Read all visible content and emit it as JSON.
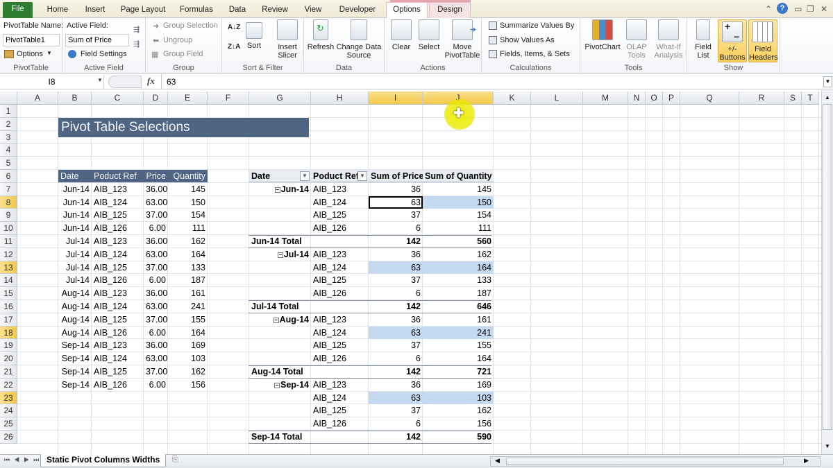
{
  "ribbon_tabs": [
    {
      "label": "File"
    },
    {
      "label": "Home"
    },
    {
      "label": "Insert"
    },
    {
      "label": "Page Layout"
    },
    {
      "label": "Formulas"
    },
    {
      "label": "Data"
    },
    {
      "label": "Review"
    },
    {
      "label": "View"
    },
    {
      "label": "Developer"
    },
    {
      "label": "Options"
    },
    {
      "label": "Design"
    }
  ],
  "ribbon": {
    "pivottable": {
      "name_label": "PivotTable Name:",
      "name_value": "PivotTable1",
      "options_label": "Options",
      "group_label": "PivotTable"
    },
    "active_field": {
      "label": "Active Field:",
      "value": "Sum of Price",
      "settings_label": "Field Settings",
      "group_label": "Active Field"
    },
    "group": {
      "selection": "Group Selection",
      "ungroup": "Ungroup",
      "field": "Group Field",
      "group_label": "Group"
    },
    "sort_filter": {
      "sort": "Sort",
      "insert_slicer": "Insert Slicer",
      "group_label": "Sort & Filter"
    },
    "data": {
      "refresh": "Refresh",
      "change_source": "Change Data Source",
      "group_label": "Data"
    },
    "actions": {
      "clear": "Clear",
      "select": "Select",
      "move": "Move PivotTable",
      "group_label": "Actions"
    },
    "calculations": {
      "summarize": "Summarize Values By",
      "show_values": "Show Values As",
      "fields_items": "Fields, Items, & Sets",
      "group_label": "Calculations"
    },
    "tools": {
      "pivotchart": "PivotChart",
      "olap": "OLAP Tools",
      "whatif": "What-If Analysis",
      "group_label": "Tools"
    },
    "show": {
      "field_list": "Field List",
      "buttons": "+/- Buttons",
      "headers": "Field Headers",
      "group_label": "Show"
    }
  },
  "formula_bar": {
    "name_box": "I8",
    "fx": "fx",
    "value": "63"
  },
  "columns": [
    "A",
    "B",
    "C",
    "D",
    "E",
    "F",
    "G",
    "H",
    "I",
    "J",
    "K",
    "L",
    "M",
    "N",
    "O",
    "P",
    "Q",
    "R",
    "S",
    "T"
  ],
  "selected_columns": [
    "I",
    "J"
  ],
  "rows": [
    "1",
    "2",
    "3",
    "4",
    "5",
    "6",
    "7",
    "8",
    "9",
    "10",
    "11",
    "12",
    "13",
    "14",
    "15",
    "16",
    "17",
    "18",
    "19",
    "20",
    "21",
    "22",
    "23",
    "24",
    "25",
    "26"
  ],
  "selected_rows": [
    "8",
    "13",
    "18",
    "23"
  ],
  "sheet_title": "Pivot Table Selections",
  "source_table": {
    "headers": [
      "Date",
      "Poduct Ref",
      "Price",
      "Quantity"
    ],
    "rows": [
      [
        "Jun-14",
        "AIB_123",
        "36.00",
        "145"
      ],
      [
        "Jun-14",
        "AIB_124",
        "63.00",
        "150"
      ],
      [
        "Jun-14",
        "AIB_125",
        "37.00",
        "154"
      ],
      [
        "Jun-14",
        "AIB_126",
        "6.00",
        "111"
      ],
      [
        "Jul-14",
        "AIB_123",
        "36.00",
        "162"
      ],
      [
        "Jul-14",
        "AIB_124",
        "63.00",
        "164"
      ],
      [
        "Jul-14",
        "AIB_125",
        "37.00",
        "133"
      ],
      [
        "Jul-14",
        "AIB_126",
        "6.00",
        "187"
      ],
      [
        "Aug-14",
        "AIB_123",
        "36.00",
        "161"
      ],
      [
        "Aug-14",
        "AIB_124",
        "63.00",
        "241"
      ],
      [
        "Aug-14",
        "AIB_125",
        "37.00",
        "155"
      ],
      [
        "Aug-14",
        "AIB_126",
        "6.00",
        "164"
      ],
      [
        "Sep-14",
        "AIB_123",
        "36.00",
        "169"
      ],
      [
        "Sep-14",
        "AIB_124",
        "63.00",
        "103"
      ],
      [
        "Sep-14",
        "AIB_125",
        "37.00",
        "162"
      ],
      [
        "Sep-14",
        "AIB_126",
        "6.00",
        "156"
      ]
    ]
  },
  "pivot_table": {
    "headers": [
      "Date",
      "Poduct Ref",
      "Sum of Price",
      "Sum of Quantity"
    ],
    "groups": [
      {
        "date": "Jun-14",
        "items": [
          [
            "AIB_123",
            "36",
            "145"
          ],
          [
            "AIB_124",
            "63",
            "150"
          ],
          [
            "AIB_125",
            "37",
            "154"
          ],
          [
            "AIB_126",
            "6",
            "111"
          ]
        ],
        "total_label": "Jun-14 Total",
        "total_price": "142",
        "total_qty": "560"
      },
      {
        "date": "Jul-14",
        "items": [
          [
            "AIB_123",
            "36",
            "162"
          ],
          [
            "AIB_124",
            "63",
            "164"
          ],
          [
            "AIB_125",
            "37",
            "133"
          ],
          [
            "AIB_126",
            "6",
            "187"
          ]
        ],
        "total_label": "Jul-14 Total",
        "total_price": "142",
        "total_qty": "646"
      },
      {
        "date": "Aug-14",
        "items": [
          [
            "AIB_123",
            "36",
            "161"
          ],
          [
            "AIB_124",
            "63",
            "241"
          ],
          [
            "AIB_125",
            "37",
            "155"
          ],
          [
            "AIB_126",
            "6",
            "164"
          ]
        ],
        "total_label": "Aug-14 Total",
        "total_price": "142",
        "total_qty": "721"
      },
      {
        "date": "Sep-14",
        "items": [
          [
            "AIB_123",
            "36",
            "169"
          ],
          [
            "AIB_124",
            "63",
            "103"
          ],
          [
            "AIB_125",
            "37",
            "162"
          ],
          [
            "AIB_126",
            "6",
            "156"
          ]
        ],
        "total_label": "Sep-14 Total",
        "total_price": "142",
        "total_qty": "590"
      }
    ],
    "selected_item": "AIB_124",
    "selection_color": "#c5d9f1"
  },
  "sheet_tabs": [
    {
      "label": "Static Pivot Columns Widths"
    }
  ],
  "colors": {
    "header_fill": "#4f6582",
    "file_tab": "#2f7d32",
    "selected_header": "#f3c94a"
  }
}
